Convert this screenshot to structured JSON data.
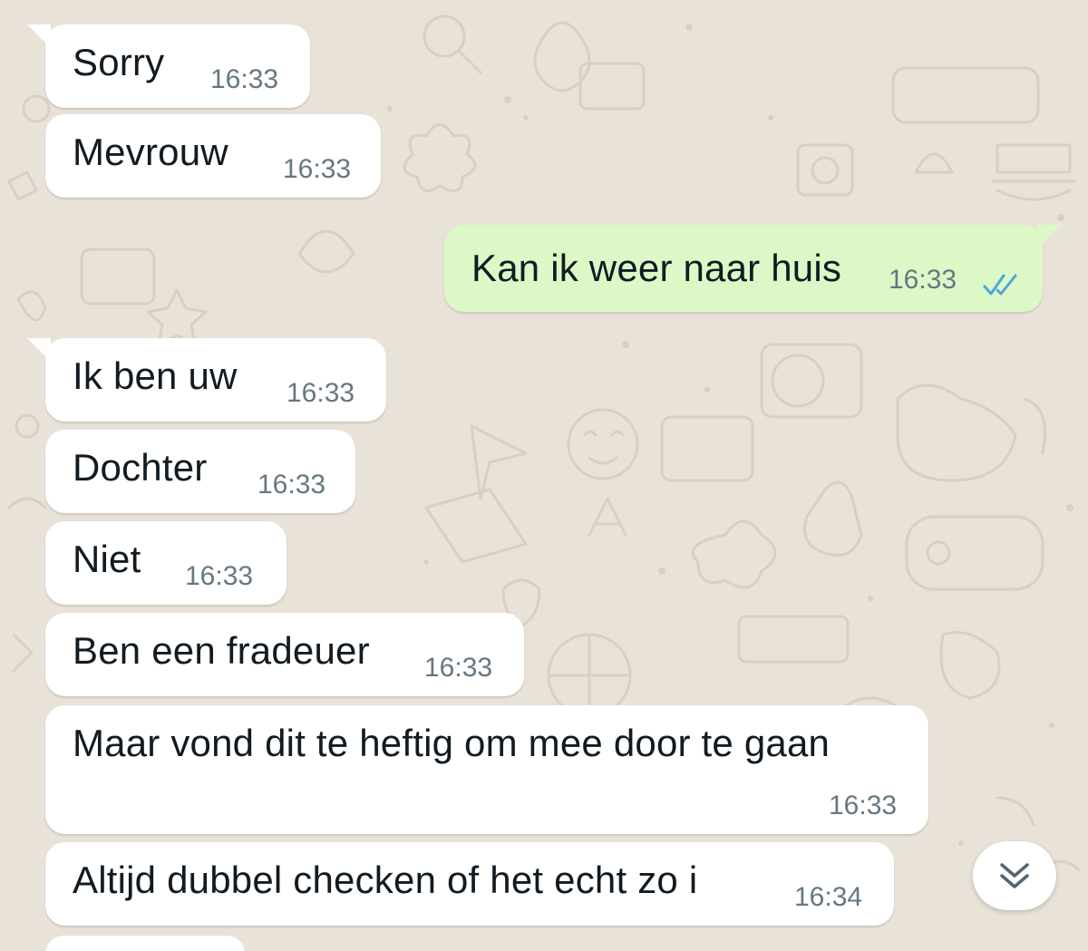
{
  "chat": {
    "messages": [
      {
        "direction": "in",
        "text": "Sorry",
        "time": "16:33"
      },
      {
        "direction": "in",
        "text": "Mevrouw",
        "time": "16:33"
      },
      {
        "direction": "out",
        "text": "Kan ik weer naar huis",
        "time": "16:33",
        "status": "double-check-read"
      },
      {
        "direction": "in",
        "text": "Ik ben uw",
        "time": "16:33"
      },
      {
        "direction": "in",
        "text": "Dochter",
        "time": "16:33"
      },
      {
        "direction": "in",
        "text": "Niet",
        "time": "16:33"
      },
      {
        "direction": "in",
        "text": "Ben een fradeuer",
        "time": "16:33"
      },
      {
        "direction": "in",
        "text": "Maar vond dit te heftig om mee door te gaan",
        "time": "16:33"
      },
      {
        "direction": "in",
        "text": "Altijd dubbel checken of het echt zo i",
        "time": "16:34"
      }
    ]
  },
  "scroll_button": {
    "icon": "double-chevron-down-icon"
  },
  "colors": {
    "background": "#e9e2d8",
    "incoming_bubble": "#ffffff",
    "outgoing_bubble": "#dcf8c6",
    "time_text": "#667781",
    "read_ticks": "#4fa6e0"
  }
}
